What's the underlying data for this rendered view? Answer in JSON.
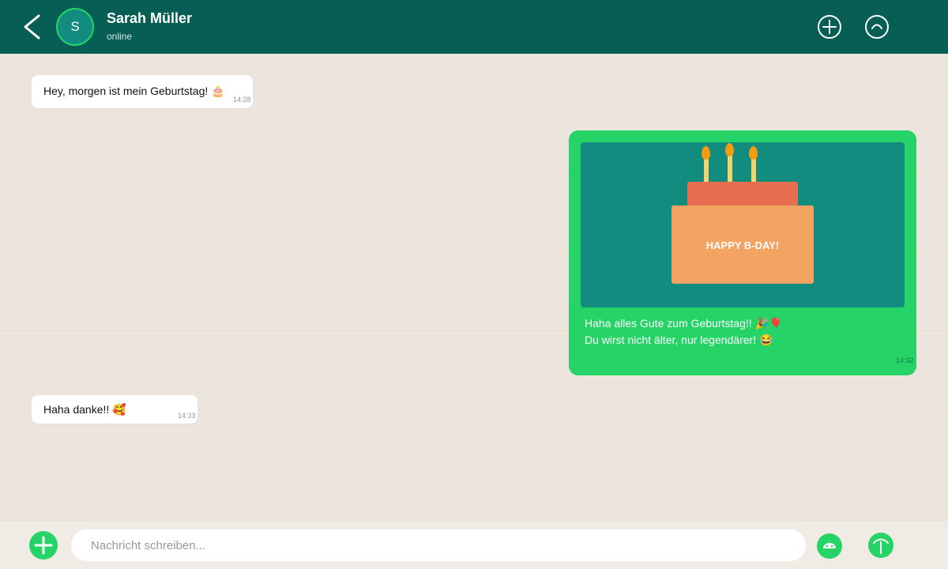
{
  "header": {
    "avatar_letter": "S",
    "contact_name": "Sarah Müller",
    "status": "online"
  },
  "icons": {
    "back": "chevron-left-icon",
    "add_contact": "plus-circle-icon",
    "menu": "arc-circle-icon",
    "attach": "plus-icon",
    "emoji": "smiley-icon",
    "voice": "microphone-icon"
  },
  "colors": {
    "header": "#075e54",
    "accent": "#25d366",
    "chat_background": "#ece5de",
    "image_background": "#128c7e",
    "cake_body": "#f3a462",
    "cake_top": "#e76f51"
  },
  "messages": [
    {
      "direction": "incoming",
      "text": "Hey, morgen ist mein Geburtstag! 🎂",
      "time": "14:28"
    },
    {
      "direction": "outgoing",
      "image_caption": "HAPPY B-DAY!",
      "lines": [
        "Haha alles Gute zum Geburtstag!! 🎉🎈",
        "Du wirst nicht älter, nur legendärer! 😂"
      ],
      "time": "14:32"
    },
    {
      "direction": "incoming",
      "text": "Haha danke!! 🥰",
      "time": "14:33"
    }
  ],
  "composer": {
    "placeholder": "Nachricht schreiben...",
    "value": ""
  }
}
